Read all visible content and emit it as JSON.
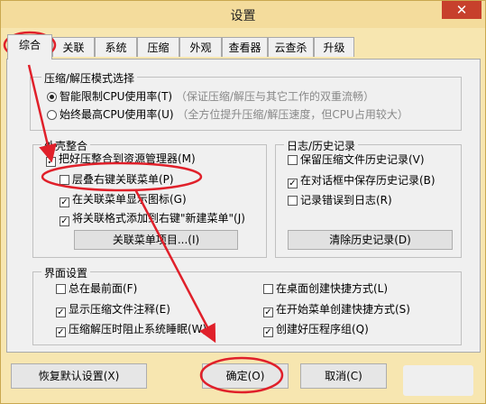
{
  "window": {
    "title": "设置",
    "close_glyph": "✕"
  },
  "tabs": [
    {
      "label": "综合",
      "active": true
    },
    {
      "label": "关联"
    },
    {
      "label": "系统"
    },
    {
      "label": "压缩"
    },
    {
      "label": "外观"
    },
    {
      "label": "查看器"
    },
    {
      "label": "云查杀"
    },
    {
      "label": "升级"
    }
  ],
  "mode_group": {
    "title": "压缩/解压模式选择",
    "opt1": {
      "label": "智能限制CPU使用率(T)",
      "hint": "（保证压缩/解压与其它工作的双重流畅）",
      "selected": true
    },
    "opt2": {
      "label": "始终最高CPU使用率(U)",
      "hint": "（全方位提升压缩/解压速度，但CPU占用较大）",
      "selected": false
    }
  },
  "shell_group": {
    "title": "外壳整合",
    "items": [
      {
        "label": "把好压整合到资源管理器(M)",
        "checked": true
      },
      {
        "label": "层叠右键关联菜单(P)",
        "checked": false
      },
      {
        "label": "在关联菜单显示图标(G)",
        "checked": true
      },
      {
        "label": "将关联格式添加到右键\"新建菜单\"(J)",
        "checked": true
      }
    ],
    "button": "关联菜单项目...(I)"
  },
  "log_group": {
    "title": "日志/历史记录",
    "items": [
      {
        "label": "保留压缩文件历史记录(V)",
        "checked": false
      },
      {
        "label": "在对话框中保存历史记录(B)",
        "checked": true
      },
      {
        "label": "记录错误到日志(R)",
        "checked": false
      }
    ],
    "button": "清除历史记录(D)"
  },
  "ui_group": {
    "title": "界面设置",
    "left": [
      {
        "label": "总在最前面(F)",
        "checked": false
      },
      {
        "label": "显示压缩文件注释(E)",
        "checked": true
      },
      {
        "label": "压缩解压时阻止系统睡眠(W)",
        "checked": true
      }
    ],
    "right": [
      {
        "label": "在桌面创建快捷方式(L)",
        "checked": false
      },
      {
        "label": "在开始菜单创建快捷方式(S)",
        "checked": true
      },
      {
        "label": "创建好压程序组(Q)",
        "checked": true
      }
    ]
  },
  "footer": {
    "restore": "恢复默认设置(X)",
    "ok": "确定(O)",
    "cancel": "取消(C)"
  },
  "colors": {
    "annotation": "#e0202a",
    "title_bar": "#f4dc9c",
    "panel": "#f0f0f0"
  },
  "check_glyph": "✓"
}
